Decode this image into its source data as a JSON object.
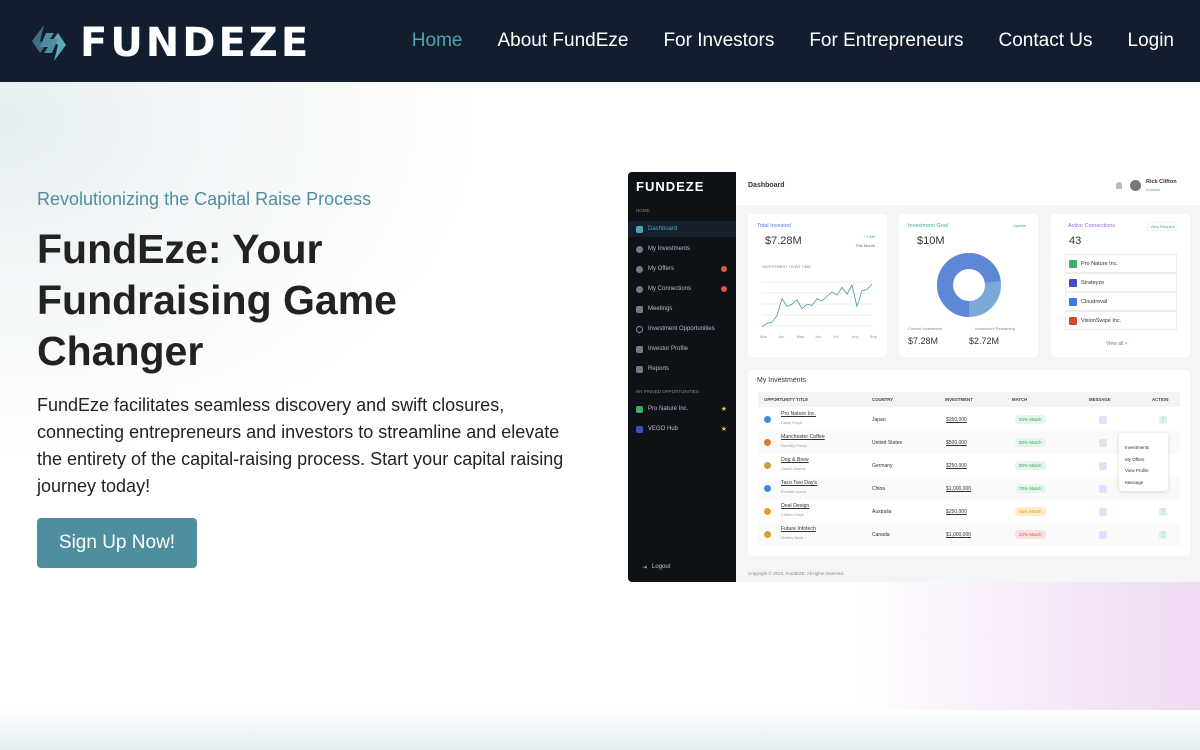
{
  "nav": {
    "logo": "FUNDEZE",
    "items": [
      {
        "label": "Home",
        "active": true
      },
      {
        "label": "About FundEze"
      },
      {
        "label": "For Investors"
      },
      {
        "label": "For Entrepreneurs"
      },
      {
        "label": "Contact Us"
      },
      {
        "label": "Login"
      }
    ]
  },
  "hero": {
    "tagline": "Revolutionizing the Capital Raise Process",
    "title": "FundEze: Your Fundraising Game Changer",
    "description": "FundEze facilitates seamless discovery and swift closures, connecting entrepreneurs and investors to streamline and elevate the entirety of the capital-raising process. Start your capital raising journey today!",
    "cta": "Sign Up Now!"
  },
  "colors": {
    "nav_bg": "#121e2e",
    "accent": "#4f8ea0",
    "active_link": "#4fa3b6"
  },
  "dashboard": {
    "logo": "FUNDEZE",
    "header": "Dashboard",
    "user": {
      "name": "Rick Clifton",
      "role": "Investor"
    },
    "sidebar": {
      "section_home": "HOME",
      "items": [
        {
          "label": "Dashboard",
          "active": true
        },
        {
          "label": "My Investments"
        },
        {
          "label": "My Offers",
          "badge": "2"
        },
        {
          "label": "My Connections",
          "badge": "6"
        },
        {
          "label": "Meetings"
        },
        {
          "label": "Investment Opportunities"
        },
        {
          "label": "Investor Profile"
        },
        {
          "label": "Reports"
        }
      ],
      "section_pinned": "MY PINNED OPPORTUNITIES",
      "pinned": [
        "Pro Nature Inc.",
        "VEGO Hub"
      ],
      "logout": "Logout"
    },
    "total": {
      "label": "Total Invested",
      "value": "$7.28M",
      "delta": "+1.8M",
      "period": "This Month",
      "chart_title": "INVESTMENT OVER TIME",
      "months": [
        "Mar",
        "Apr",
        "May",
        "Jun",
        "Jul",
        "Aug",
        "Sep"
      ],
      "series": [
        2,
        5,
        6,
        12,
        27,
        20,
        22,
        26,
        18,
        22,
        21,
        27,
        25,
        29,
        33,
        30,
        37,
        31,
        39,
        20,
        34,
        35,
        40
      ]
    },
    "goal": {
      "label": "Investment Goal",
      "update": "Update",
      "value": "$10M",
      "current_label": "Current Investment",
      "remaining_label": "Investment Remaining",
      "current": "$7.28M",
      "remaining": "$2.72M",
      "current_fraction": 0.728
    },
    "connections": {
      "label": "Active Connections",
      "view_request": "View Request",
      "count": "43",
      "items": [
        "Pro Nature Inc.",
        "Strateyze",
        "Cloudreval",
        "VisionSwipe Inc."
      ],
      "view_all": "View all >"
    },
    "investments": {
      "title": "My Investments",
      "columns": [
        "OPPORTUNITY TITLE",
        "COUNTRY",
        "INVESTMENT",
        "MATCH",
        "MESSAGE",
        "ACTION"
      ],
      "rows": [
        {
          "title": "Pro Nature Inc.",
          "person": "Daisy Floyd",
          "country": "Japan",
          "investment": "$250,000",
          "match": "93% Match",
          "level": "good"
        },
        {
          "title": "Manchester Coffee",
          "person": "Dorothy Fisher",
          "country": "United States",
          "investment": "$500,000",
          "match": "82% Match",
          "level": "good"
        },
        {
          "title": "Dog & Brew",
          "person": "Daniel Adams",
          "country": "Germany",
          "investment": "$250,000",
          "match": "80% Match",
          "level": "good"
        },
        {
          "title": "Taco Two Day's",
          "person": "Freddie Lynch",
          "country": "China",
          "investment": "$1,000,000",
          "match": "70% Match",
          "level": "good"
        },
        {
          "title": "Deal Design",
          "person": "Clifford Hays",
          "country": "Australia",
          "investment": "$250,000",
          "match": "45% Match",
          "level": "mid"
        },
        {
          "title": "Future Infotech",
          "person": "Shirley Beck",
          "country": "Canada",
          "investment": "$1,000,000",
          "match": "22% Match",
          "level": "low"
        }
      ],
      "menu": [
        "Investments",
        "My Offers",
        "View Profile",
        "Message"
      ]
    },
    "footer": "Copyright © 2023, FundEZE. All rights reserved."
  }
}
